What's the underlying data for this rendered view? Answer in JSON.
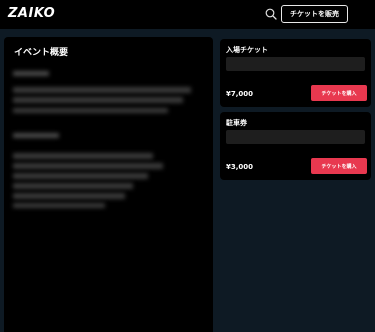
{
  "header": {
    "logo": "ZAIKO",
    "search_icon": "search-icon",
    "sell_button": "チケットを販売"
  },
  "event": {
    "section_title": "イベント概要"
  },
  "tickets": [
    {
      "name": "入場チケット",
      "price": "¥7,000",
      "buy_label": "チケットを購入"
    },
    {
      "name": "駐車券",
      "price": "¥3,000",
      "buy_label": "チケットを購入"
    }
  ],
  "colors": {
    "accent": "#e8384f",
    "background": "#0e1a24",
    "panel": "#000000"
  }
}
